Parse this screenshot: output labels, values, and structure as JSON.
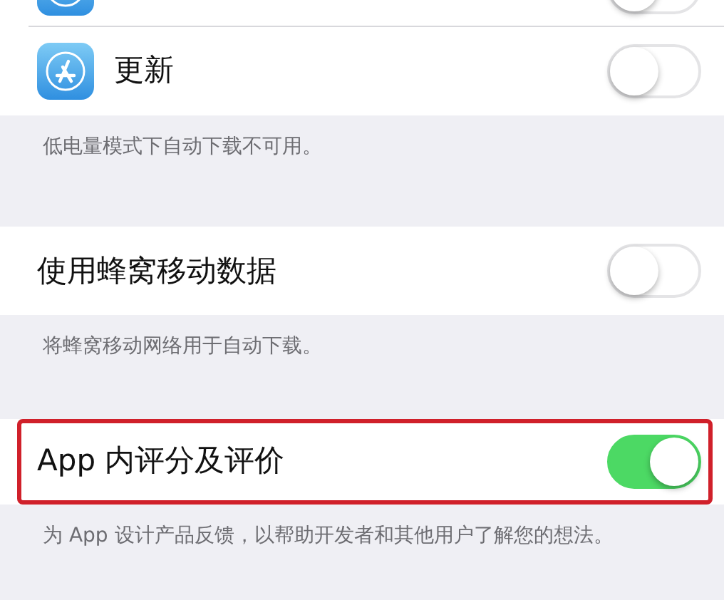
{
  "sections": [
    {
      "rows": [
        {
          "kind": "cut-icon",
          "on": false
        },
        {
          "kind": "icon",
          "label": "更新",
          "on": false
        }
      ],
      "footer": "低电量模式下自动下载不可用。"
    },
    {
      "rows": [
        {
          "kind": "plain",
          "label": "使用蜂窝移动数据",
          "on": false
        }
      ],
      "footer": "将蜂窝移动网络用于自动下载。"
    },
    {
      "rows": [
        {
          "kind": "plain",
          "label": "App 内评分及评价",
          "on": true,
          "highlighted": true
        }
      ],
      "footer": "为 App 设计产品反馈，以帮助开发者和其他用户了解您的想法。"
    }
  ]
}
